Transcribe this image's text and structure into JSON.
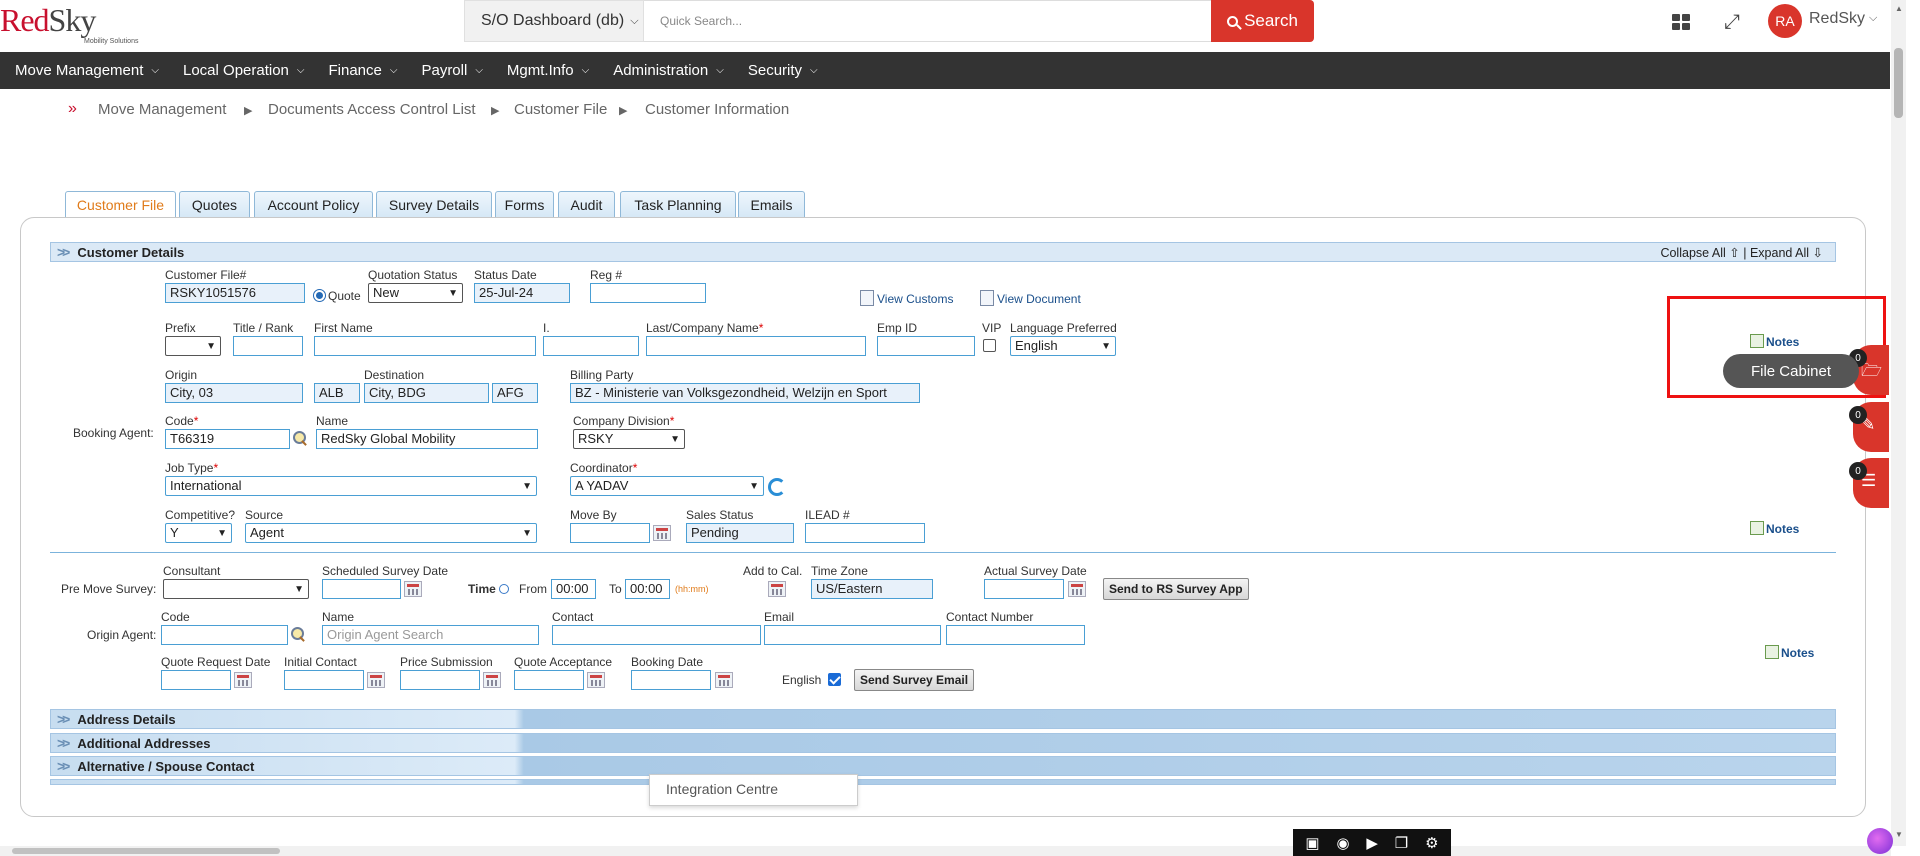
{
  "header": {
    "logo_main_red": "Red",
    "logo_main_dark": "Sky",
    "logo_sub": "Mobility Solutions",
    "dashboard_select": "S/O Dashboard (db)",
    "quick_search_placeholder": "Quick Search...",
    "search_label": "Search",
    "user_initials": "RA",
    "user_name": "RedSky"
  },
  "nav": {
    "items": [
      "Move Management",
      "Local Operation",
      "Finance",
      "Payroll",
      "Mgmt.Info",
      "Administration",
      "Security"
    ]
  },
  "breadcrumb": [
    "Move Management",
    "Documents Access Control List",
    "Customer File",
    "Customer Information"
  ],
  "tabs": [
    "Customer File",
    "Quotes",
    "Account Policy",
    "Survey Details",
    "Forms",
    "Audit",
    "Task Planning",
    "Emails"
  ],
  "active_tab": "Customer File",
  "sections": {
    "customer_details": "Customer Details",
    "collapse_all": "Collapse All",
    "expand_all": "Expand All",
    "address_details": "Address Details",
    "additional_addresses": "Additional Addresses",
    "alternative_contact": "Alternative / Spouse Contact"
  },
  "customer": {
    "file_no_label": "Customer File#",
    "file_no": "RSKY1051576",
    "quote_radio": "Quote",
    "quotation_status_label": "Quotation Status",
    "quotation_status": "New",
    "status_date_label": "Status Date",
    "status_date": "25-Jul-24",
    "reg_label": "Reg #",
    "reg_value": "",
    "view_customs": "View Customs",
    "view_document": "View Document",
    "prefix_label": "Prefix",
    "title_rank_label": "Title / Rank",
    "first_name_label": "First Name",
    "initial_label": "I.",
    "last_name_label": "Last/Company Name",
    "emp_id_label": "Emp ID",
    "vip_label": "VIP",
    "language_label": "Language Preferred",
    "language": "English",
    "origin_label": "Origin",
    "origin_city": "City, 03",
    "origin_country": "ALB",
    "destination_label": "Destination",
    "destination_city": "City, BDG",
    "destination_country": "AFG",
    "billing_party_label": "Billing Party",
    "billing_party": "BZ - Ministerie van Volksgezondheid, Welzijn en Sport",
    "booking_agent_label": "Booking Agent:",
    "code_label": "Code",
    "code": "T66319",
    "name_label": "Name",
    "agent_name": "RedSky Global Mobility",
    "company_division_label": "Company Division",
    "company_division": "RSKY",
    "job_type_label": "Job Type",
    "job_type": "International",
    "coordinator_label": "Coordinator",
    "coordinator": "A YADAV",
    "competitive_label": "Competitive?",
    "competitive": "Y",
    "source_label": "Source",
    "source": "Agent",
    "move_by_label": "Move By",
    "sales_status_label": "Sales Status",
    "sales_status": "Pending",
    "ilead_label": "ILEAD #",
    "notes": "Notes"
  },
  "survey": {
    "pre_move_label": "Pre Move Survey:",
    "consultant_label": "Consultant",
    "scheduled_label": "Scheduled Survey Date",
    "time_label": "Time",
    "from_label": "From",
    "from_value": "00:00",
    "to_label": "To",
    "to_value": "00:00",
    "hhmm": "(hh:mm)",
    "add_to_cal": "Add to Cal.",
    "time_zone_label": "Time Zone",
    "time_zone": "US/Eastern",
    "actual_label": "Actual Survey Date",
    "send_rs_button": "Send to RS Survey App",
    "origin_agent_label": "Origin Agent:",
    "code_label": "Code",
    "name_label": "Name",
    "name_placeholder": "Origin Agent Search",
    "contact_label": "Contact",
    "email_label": "Email",
    "contact_number_label": "Contact Number",
    "quote_request_label": "Quote Request Date",
    "initial_contact_label": "Initial Contact",
    "price_submission_label": "Price Submission",
    "quote_acceptance_label": "Quote Acceptance",
    "booking_date_label": "Booking Date",
    "english_label": "English",
    "send_survey_email": "Send Survey Email"
  },
  "side_widgets": {
    "file_cabinet": "File Cabinet",
    "badges": [
      "0",
      "0",
      "0"
    ]
  },
  "popup": {
    "integration_centre": "Integration Centre"
  }
}
